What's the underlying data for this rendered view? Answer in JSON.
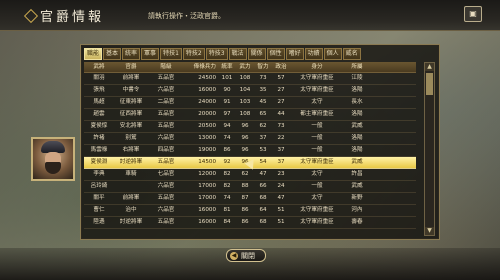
{
  "header": {
    "title": "官爵情報",
    "hint": "請執行操作・泛政官爵。",
    "corner_icon": "settings-icon"
  },
  "tabs": [
    {
      "label": "職能",
      "active": true
    },
    {
      "label": "基本"
    },
    {
      "label": "統率"
    },
    {
      "label": "軍事"
    },
    {
      "label": "特技1"
    },
    {
      "label": "特技2"
    },
    {
      "label": "特技3"
    },
    {
      "label": "戰法"
    },
    {
      "label": "關係"
    },
    {
      "label": "個性"
    },
    {
      "label": "嗜好"
    },
    {
      "label": "功績"
    },
    {
      "label": "個人"
    },
    {
      "label": "威名"
    }
  ],
  "table": {
    "headers": [
      "武將",
      "官爵",
      "階級",
      "俸祿兵力",
      "統率",
      "武力",
      "智力",
      "政治",
      "身分",
      "所屬"
    ],
    "rows": [
      [
        "關羽",
        "前將軍",
        "五品官",
        "24500",
        "101",
        "108",
        "73",
        "57",
        "太守軍府重臣",
        "江陵"
      ],
      [
        "張飛",
        "中書令",
        "六品官",
        "16000",
        "90",
        "104",
        "35",
        "27",
        "太守軍府重臣",
        "洛陽"
      ],
      [
        "馬超",
        "征東將軍",
        "二品官",
        "24000",
        "91",
        "103",
        "45",
        "27",
        "太守",
        "長水"
      ],
      [
        "趙雲",
        "征西將軍",
        "五品官",
        "20000",
        "97",
        "108",
        "65",
        "44",
        "都主軍府重臣",
        "洛陽"
      ],
      [
        "夏侯惇",
        "安北將軍",
        "五品官",
        "20500",
        "94",
        "96",
        "62",
        "73",
        "一般",
        "武威"
      ],
      [
        "許褚",
        "别駕",
        "六品官",
        "13000",
        "74",
        "96",
        "37",
        "22",
        "一般",
        "洛陽"
      ],
      [
        "馬雲祿",
        "右將軍",
        "四品官",
        "19000",
        "86",
        "96",
        "53",
        "37",
        "一般",
        "洛陽"
      ],
      [
        "夏侯淵",
        "討逆將軍",
        "五品官",
        "14500",
        "92",
        "96",
        "54",
        "37",
        "太守軍府重臣",
        "武威"
      ],
      [
        "李典",
        "車騎",
        "七品官",
        "12000",
        "82",
        "62",
        "47",
        "23",
        "太守",
        "許昌"
      ],
      [
        "呂玲綺",
        "",
        "六品官",
        "17000",
        "82",
        "88",
        "66",
        "24",
        "一般",
        "武威"
      ],
      [
        "關平",
        "前將軍",
        "五品官",
        "17000",
        "74",
        "87",
        "68",
        "47",
        "太守",
        "新野"
      ],
      [
        "曹仁",
        "治中",
        "六品官",
        "16000",
        "81",
        "86",
        "64",
        "51",
        "太守軍府重臣",
        "河內"
      ],
      [
        "陸遜",
        "討逆將軍",
        "五品官",
        "16000",
        "84",
        "86",
        "68",
        "51",
        "太守軍府重臣",
        "壽春"
      ]
    ],
    "selected_row": 7
  },
  "portrait_icon": "general-portrait-icon",
  "footer": {
    "close_label": "關閉"
  }
}
